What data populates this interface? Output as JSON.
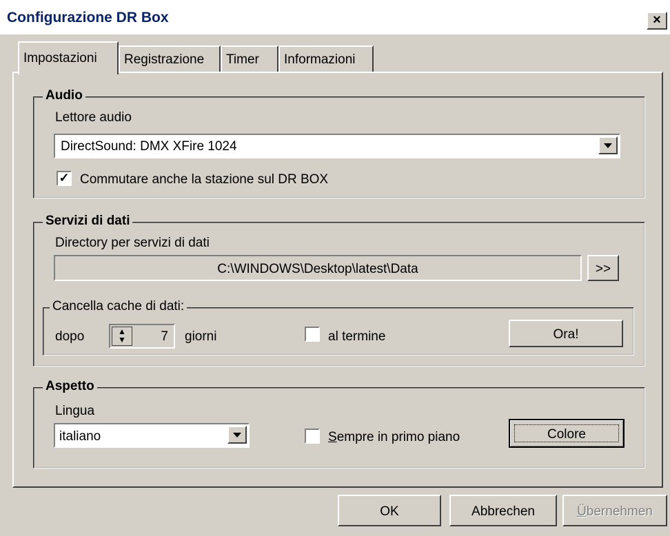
{
  "window": {
    "title": "Configurazione DR Box",
    "close_glyph": "×"
  },
  "tabs": [
    {
      "label": "Impostazioni",
      "active": true
    },
    {
      "label": "Registrazione",
      "active": false
    },
    {
      "label": "Timer",
      "active": false
    },
    {
      "label": "Informazioni",
      "active": false
    }
  ],
  "audio": {
    "legend": "Audio",
    "player_label": "Lettore audio",
    "player_value": "DirectSound: DMX XFire 1024",
    "switch_station_label": "Commutare anche la stazione sul DR BOX",
    "switch_station_checked": "✓"
  },
  "data_services": {
    "legend": "Servizi di dati",
    "directory_label": "Directory per servizi di dati",
    "directory_value": "C:\\WINDOWS\\Desktop\\latest\\Data",
    "browse_label": ">>",
    "cache": {
      "legend": "Cancella cache di dati:",
      "after_label": "dopo",
      "days_value": "7",
      "days_unit": "giorni",
      "on_exit_label": "al termine",
      "on_exit_checked": false,
      "now_button": "Ora!"
    }
  },
  "appearance": {
    "legend": "Aspetto",
    "language_label": "Lingua",
    "language_value": "italiano",
    "always_on_top_first": "S",
    "always_on_top_rest": "empre in primo piano",
    "always_on_top_checked": false,
    "color_button": "Colore"
  },
  "footer": {
    "ok": "OK",
    "cancel": "Abbrechen",
    "apply_first": "Ü",
    "apply_rest": "bernehmen"
  }
}
